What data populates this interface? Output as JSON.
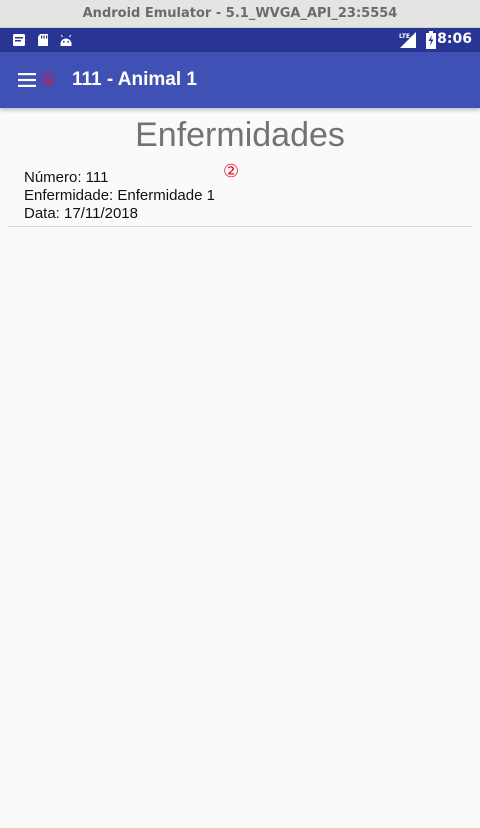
{
  "window": {
    "title": "Android Emulator - 5.1_WVGA_API_23:5554"
  },
  "status_bar": {
    "left_icons": [
      "notification-icon",
      "sd-card-icon",
      "android-icon"
    ],
    "network_label": "LTE",
    "time": "8:06"
  },
  "app_bar": {
    "menu_icon": "hamburger-menu-icon",
    "marker_1": "①",
    "title": "111 - Animal 1"
  },
  "main": {
    "heading": "Enfermidades",
    "marker_2": "②",
    "records": [
      {
        "numero": "Número: 111",
        "enfermidade": "Enfermidade: Enfermidade 1",
        "data": "Data: 17/11/2018"
      }
    ]
  },
  "colors": {
    "status_bar": "#283593",
    "app_bar": "#3f51b5",
    "background": "#fafafa",
    "marker": "#e0102a"
  }
}
